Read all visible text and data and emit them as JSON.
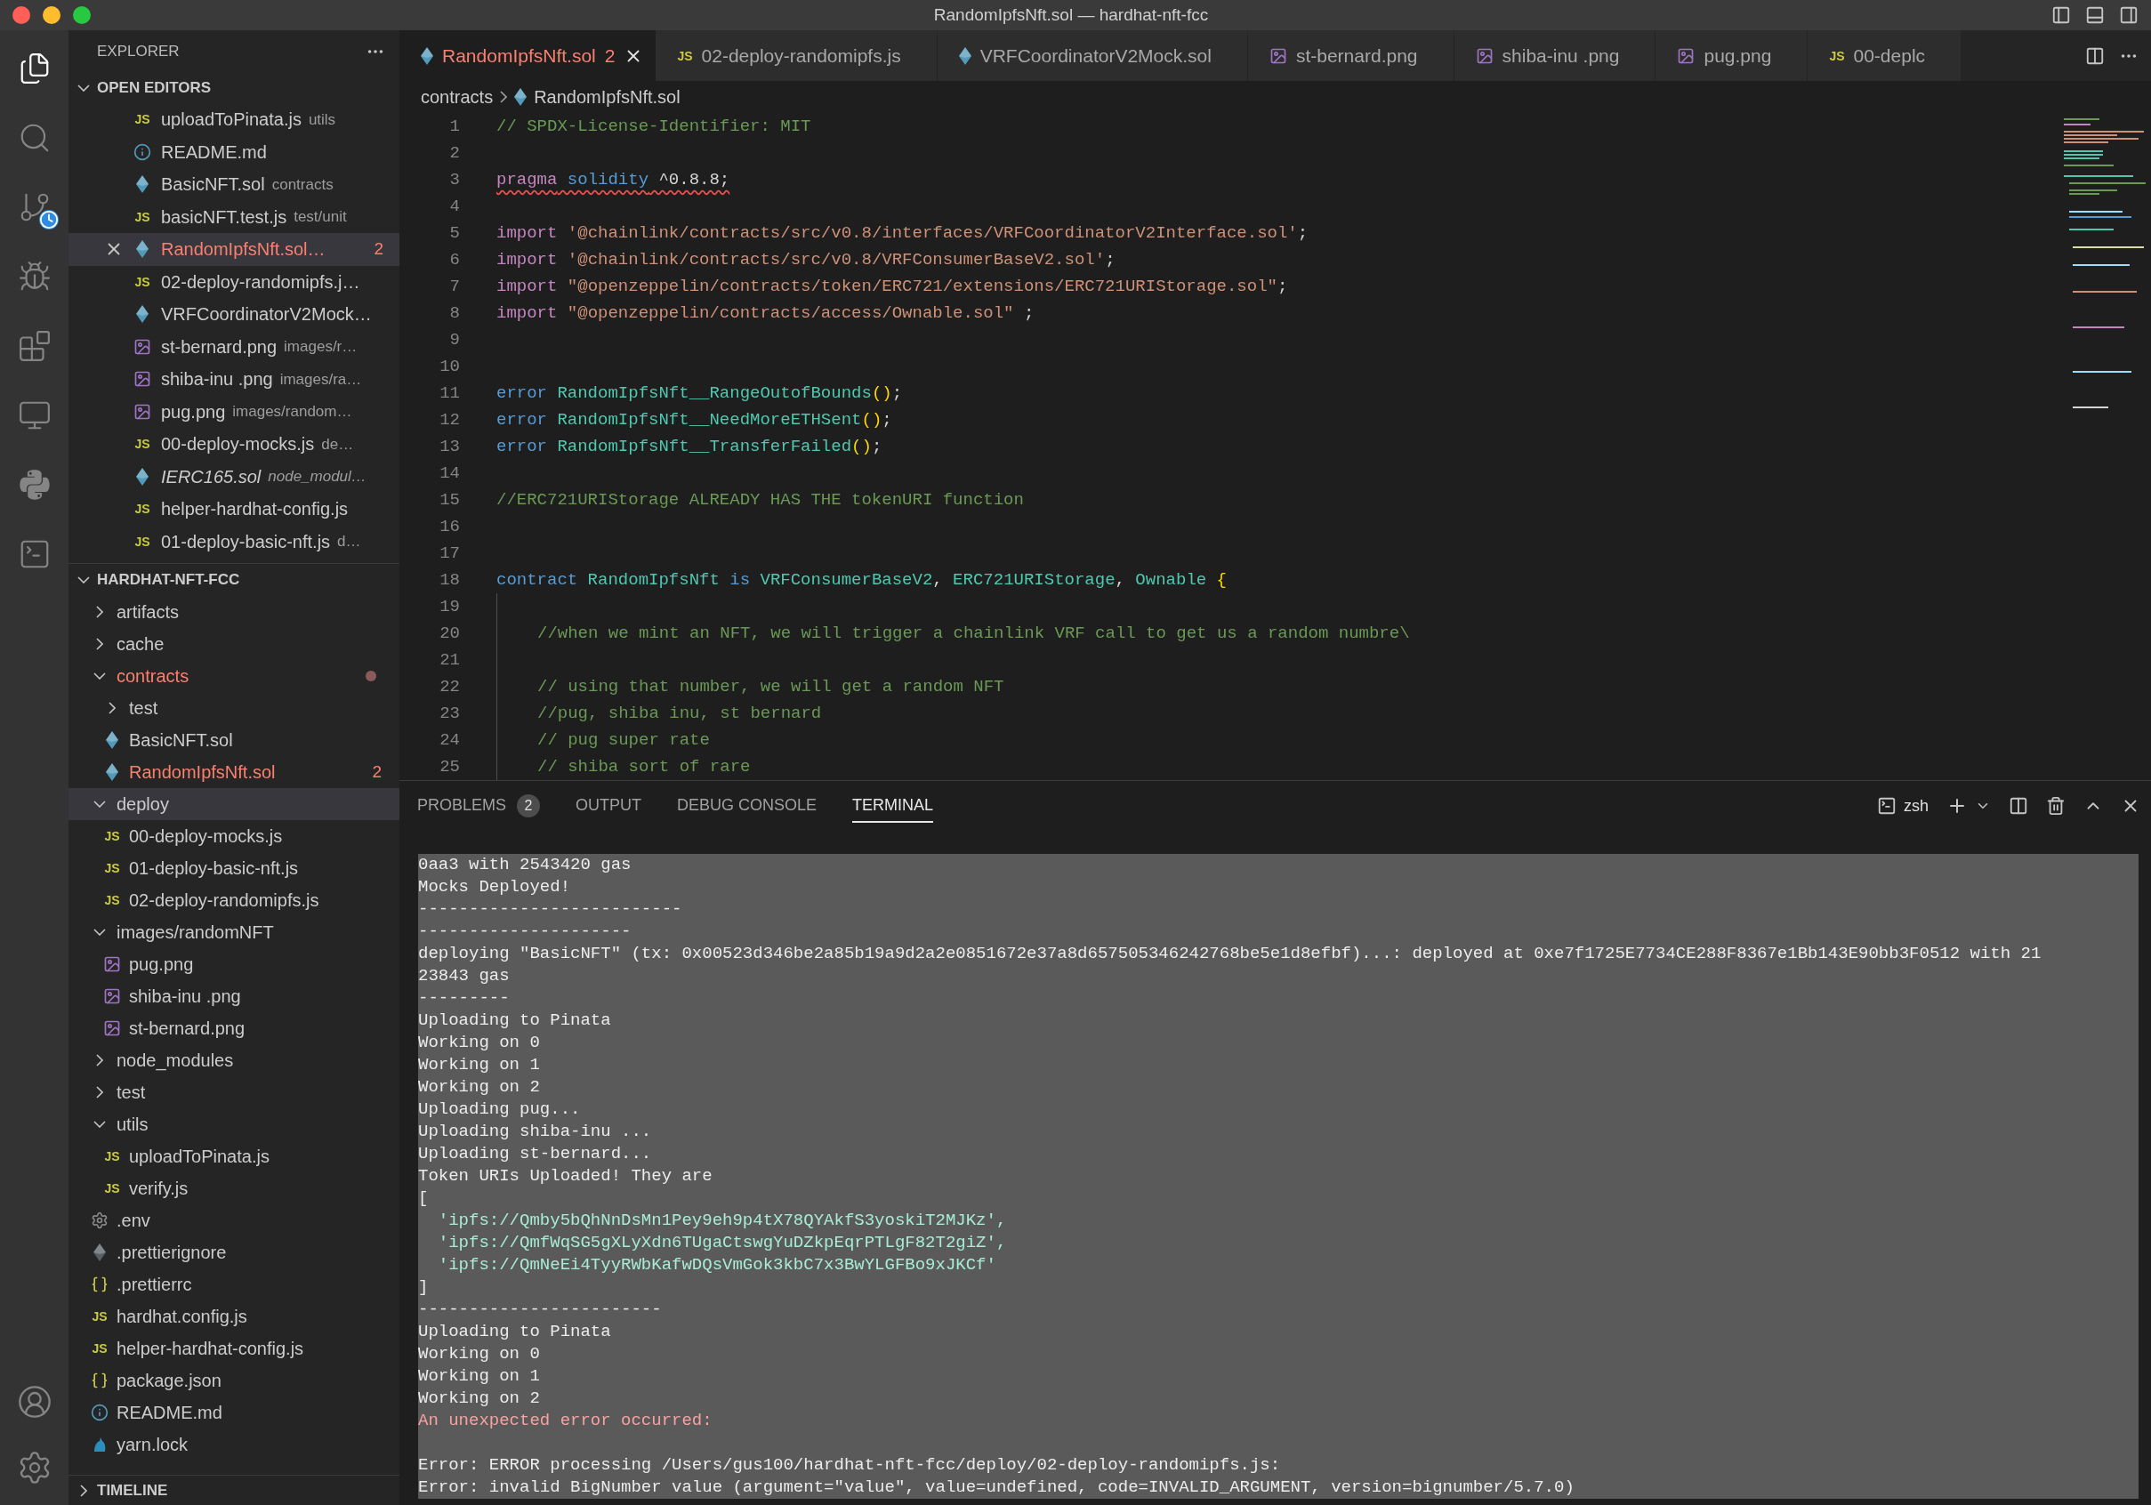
{
  "window": {
    "title": "RandomIpfsNft.sol — hardhat-nft-fcc"
  },
  "activity_bar": [
    {
      "selected": true
    },
    {
      "selected": false
    },
    {
      "selected": false
    },
    {
      "selected": false
    },
    {
      "selected": false
    },
    {
      "selected": false
    },
    {
      "selected": false
    },
    {
      "selected": false
    }
  ],
  "sidebar": {
    "title": "EXPLORER",
    "open_editors": {
      "title": "OPEN EDITORS",
      "expanded": true,
      "items": [
        {
          "name": "uploadToPinata.js",
          "detail": "utils",
          "kind": "js",
          "icon_label": "JS",
          "selected": false,
          "error": false,
          "preview": false
        },
        {
          "name": "README.md",
          "kind": "info",
          "selected": false,
          "error": false,
          "preview": false
        },
        {
          "name": "BasicNFT.sol",
          "detail": "contracts",
          "kind": "sol",
          "selected": false,
          "error": false,
          "preview": false
        },
        {
          "name": "basicNFT.test.js",
          "detail": "test/unit",
          "kind": "js",
          "icon_label": "JS",
          "selected": false,
          "error": false,
          "preview": false
        },
        {
          "name": "RandomIpfsNft.sol…",
          "kind": "sol",
          "problems": "2",
          "selected": true,
          "error": true,
          "preview": false
        },
        {
          "name": "02-deploy-randomipfs.j…",
          "kind": "js",
          "icon_label": "JS",
          "selected": false,
          "error": false,
          "preview": false
        },
        {
          "name": "VRFCoordinatorV2Mock…",
          "kind": "sol",
          "selected": false,
          "error": false,
          "preview": false
        },
        {
          "name": "st-bernard.png",
          "detail": "images/r…",
          "kind": "image",
          "selected": false,
          "error": false,
          "preview": false
        },
        {
          "name": "shiba-inu .png",
          "detail": "images/ra…",
          "kind": "image",
          "selected": false,
          "error": false,
          "preview": false
        },
        {
          "name": "pug.png",
          "detail": "images/random…",
          "kind": "image",
          "selected": false,
          "error": false,
          "preview": false
        },
        {
          "name": "00-deploy-mocks.js",
          "detail": "de…",
          "kind": "js",
          "icon_label": "JS",
          "selected": false,
          "error": false,
          "preview": false
        },
        {
          "name": "IERC165.sol",
          "detail": "node_modul…",
          "kind": "sol",
          "selected": false,
          "error": false,
          "preview": true
        },
        {
          "name": "helper-hardhat-config.js",
          "kind": "js",
          "icon_label": "JS",
          "selected": false,
          "error": false,
          "preview": false
        },
        {
          "name": "01-deploy-basic-nft.js",
          "detail": "d…",
          "kind": "js",
          "icon_label": "JS",
          "selected": false,
          "error": false,
          "preview": false
        }
      ]
    },
    "project": {
      "title": "HARDHAT-NFT-FCC",
      "expanded": true,
      "children": [
        {
          "name": "artifacts",
          "kind": "folder",
          "expanded": false,
          "selected": false,
          "error": false
        },
        {
          "name": "cache",
          "kind": "folder",
          "expanded": false,
          "selected": false,
          "error": false
        },
        {
          "name": "contracts",
          "kind": "folder",
          "expanded": true,
          "selected": false,
          "error": true,
          "children": [
            {
              "name": "test",
              "kind": "folder",
              "expanded": false,
              "selected": false,
              "error": false
            },
            {
              "name": "BasicNFT.sol",
              "kind": "sol",
              "selected": false,
              "error": false
            },
            {
              "name": "RandomIpfsNft.sol",
              "kind": "sol",
              "problems": "2",
              "selected": false,
              "error": true
            }
          ]
        },
        {
          "name": "deploy",
          "kind": "folder",
          "expanded": true,
          "selected": true,
          "error": false,
          "children": [
            {
              "name": "00-deploy-mocks.js",
              "kind": "js",
              "icon_label": "JS",
              "selected": false,
              "error": false
            },
            {
              "name": "01-deploy-basic-nft.js",
              "kind": "js",
              "icon_label": "JS",
              "selected": false,
              "error": false
            },
            {
              "name": "02-deploy-randomipfs.js",
              "kind": "js",
              "icon_label": "JS",
              "selected": false,
              "error": false
            }
          ]
        },
        {
          "name": "images/randomNFT",
          "kind": "folder",
          "expanded": true,
          "selected": false,
          "error": false,
          "children": [
            {
              "name": "pug.png",
              "kind": "image",
              "selected": false,
              "error": false
            },
            {
              "name": "shiba-inu .png",
              "kind": "image",
              "selected": false,
              "error": false
            },
            {
              "name": "st-bernard.png",
              "kind": "image",
              "selected": false,
              "error": false
            }
          ]
        },
        {
          "name": "node_modules",
          "kind": "folder",
          "expanded": false,
          "selected": false,
          "error": false
        },
        {
          "name": "test",
          "kind": "folder",
          "expanded": false,
          "selected": false,
          "error": false
        },
        {
          "name": "utils",
          "kind": "folder",
          "expanded": true,
          "selected": false,
          "error": false,
          "children": [
            {
              "name": "uploadToPinata.js",
              "kind": "js",
              "icon_label": "JS",
              "selected": false,
              "error": false
            },
            {
              "name": "verify.js",
              "kind": "js",
              "icon_label": "JS",
              "selected": false,
              "error": false
            }
          ]
        },
        {
          "name": ".env",
          "kind": "gear",
          "selected": false,
          "error": false
        },
        {
          "name": ".prettierignore",
          "kind": "ignore",
          "selected": false,
          "error": false
        },
        {
          "name": ".prettierrc",
          "kind": "braces",
          "selected": false,
          "error": false
        },
        {
          "name": "hardhat.config.js",
          "kind": "js",
          "icon_label": "JS",
          "selected": false,
          "error": false
        },
        {
          "name": "helper-hardhat-config.js",
          "kind": "js",
          "icon_label": "JS",
          "selected": false,
          "error": false
        },
        {
          "name": "package.json",
          "kind": "braces",
          "selected": false,
          "error": false
        },
        {
          "name": "README.md",
          "kind": "info",
          "selected": false,
          "error": false
        },
        {
          "name": "yarn.lock",
          "kind": "yarn",
          "selected": false,
          "error": false
        }
      ]
    },
    "timeline": {
      "title": "TIMELINE",
      "expanded": false
    }
  },
  "tabs": [
    {
      "label": "RandomIpfsNft.sol",
      "kind": "sol",
      "problems": "2",
      "selected": true,
      "error": true
    },
    {
      "label": "02-deploy-randomipfs.js",
      "kind": "js",
      "icon_label": "JS",
      "selected": false,
      "error": false
    },
    {
      "label": "VRFCoordinatorV2Mock.sol",
      "kind": "sol",
      "selected": false,
      "error": false
    },
    {
      "label": "st-bernard.png",
      "kind": "image",
      "selected": false,
      "error": false
    },
    {
      "label": "shiba-inu .png",
      "kind": "image",
      "selected": false,
      "error": false
    },
    {
      "label": "pug.png",
      "kind": "image",
      "selected": false,
      "error": false
    },
    {
      "label": "00-deplc",
      "kind": "js",
      "icon_label": "JS",
      "selected": false,
      "error": false
    }
  ],
  "breadcrumbs": [
    {
      "label": "contracts",
      "kind": "folder"
    },
    {
      "label": "RandomIpfsNft.sol",
      "kind": "sol"
    }
  ],
  "editor": {
    "lines": [
      {
        "n": "1",
        "tokens": [
          {
            "kind": "comment",
            "text": "// SPDX-License-Identifier: MIT"
          }
        ]
      },
      {
        "n": "2"
      },
      {
        "n": "3",
        "error": true,
        "tokens": [
          {
            "kind": "keyword",
            "text": "pragma"
          },
          {
            "kind": "builtin",
            "text": " solidity"
          },
          {
            "kind": "plain",
            "text": " ^0.8.8;"
          }
        ]
      },
      {
        "n": "4"
      },
      {
        "n": "5",
        "tokens": [
          {
            "kind": "keyword",
            "text": "import"
          },
          {
            "kind": "string",
            "text": " '@chainlink/contracts/src/v0.8/interfaces/VRFCoordinatorV2Interface.sol'"
          },
          {
            "kind": "plain",
            "text": ";"
          }
        ]
      },
      {
        "n": "6",
        "tokens": [
          {
            "kind": "keyword",
            "text": "import"
          },
          {
            "kind": "string",
            "text": " '@chainlink/contracts/src/v0.8/VRFConsumerBaseV2.sol'"
          },
          {
            "kind": "plain",
            "text": ";"
          }
        ]
      },
      {
        "n": "7",
        "tokens": [
          {
            "kind": "keyword",
            "text": "import"
          },
          {
            "kind": "string",
            "text": " \"@openzeppelin/contracts/token/ERC721/extensions/ERC721URIStorage.sol\""
          },
          {
            "kind": "plain",
            "text": ";"
          }
        ]
      },
      {
        "n": "8",
        "tokens": [
          {
            "kind": "keyword",
            "text": "import"
          },
          {
            "kind": "string",
            "text": " \"@openzeppelin/contracts/access/Ownable.sol\""
          },
          {
            "kind": "plain",
            "text": " ;"
          }
        ]
      },
      {
        "n": "9"
      },
      {
        "n": "10"
      },
      {
        "n": "11",
        "tokens": [
          {
            "kind": "builtin",
            "text": "error"
          },
          {
            "kind": "type",
            "text": " RandomIpfsNft__RangeOutofBounds"
          },
          {
            "kind": "bracket",
            "text": "()"
          },
          {
            "kind": "plain",
            "text": ";"
          }
        ]
      },
      {
        "n": "12",
        "tokens": [
          {
            "kind": "builtin",
            "text": "error"
          },
          {
            "kind": "type",
            "text": " RandomIpfsNft__NeedMoreETHSent"
          },
          {
            "kind": "bracket",
            "text": "()"
          },
          {
            "kind": "plain",
            "text": ";"
          }
        ]
      },
      {
        "n": "13",
        "tokens": [
          {
            "kind": "builtin",
            "text": "error"
          },
          {
            "kind": "type",
            "text": " RandomIpfsNft__TransferFailed"
          },
          {
            "kind": "bracket",
            "text": "()"
          },
          {
            "kind": "plain",
            "text": ";"
          }
        ]
      },
      {
        "n": "14"
      },
      {
        "n": "15",
        "tokens": [
          {
            "kind": "comment",
            "text": "//ERC721URIStorage ALREADY HAS THE tokenURI function"
          }
        ]
      },
      {
        "n": "16"
      },
      {
        "n": "17"
      },
      {
        "n": "18",
        "tokens": [
          {
            "kind": "builtin",
            "text": "contract"
          },
          {
            "kind": "type",
            "text": " RandomIpfsNft"
          },
          {
            "kind": "builtin",
            "text": " is"
          },
          {
            "kind": "type",
            "text": " VRFConsumerBaseV2"
          },
          {
            "kind": "plain",
            "text": ","
          },
          {
            "kind": "type",
            "text": " ERC721URIStorage"
          },
          {
            "kind": "plain",
            "text": ","
          },
          {
            "kind": "type",
            "text": " Ownable"
          },
          {
            "kind": "bracket",
            "text": " {"
          }
        ]
      },
      {
        "n": "19",
        "indented": true
      },
      {
        "n": "20",
        "indented": true,
        "tokens": [
          {
            "kind": "comment",
            "text": "//when we mint an NFT, we will trigger a chainlink VRF call to get us a random numbre\\"
          }
        ]
      },
      {
        "n": "21",
        "indented": true
      },
      {
        "n": "22",
        "indented": true,
        "tokens": [
          {
            "kind": "comment",
            "text": "// using that number, we will get a random NFT"
          }
        ]
      },
      {
        "n": "23",
        "indented": true,
        "tokens": [
          {
            "kind": "comment",
            "text": "//pug, shiba inu, st bernard"
          }
        ]
      },
      {
        "n": "24",
        "indented": true,
        "tokens": [
          {
            "kind": "comment",
            "text": "// pug super rate"
          }
        ]
      },
      {
        "n": "25",
        "indented": true,
        "tokens": [
          {
            "kind": "comment",
            "text": "// shiba sort of rare"
          }
        ]
      }
    ]
  },
  "panel": {
    "tabs": [
      {
        "label": "PROBLEMS",
        "badge": "2",
        "selected": false
      },
      {
        "label": "OUTPUT",
        "selected": false
      },
      {
        "label": "DEBUG CONSOLE",
        "selected": false
      },
      {
        "label": "TERMINAL",
        "selected": true
      }
    ],
    "shell": "zsh",
    "terminal": [
      {
        "kind": "out",
        "text": "0aa3 with 2543420 gas"
      },
      {
        "kind": "out",
        "text": "Mocks Deployed!"
      },
      {
        "kind": "out",
        "text": "--------------------------"
      },
      {
        "kind": "out",
        "text": "---------------------"
      },
      {
        "kind": "out",
        "text": "deploying \"BasicNFT\" (tx: 0x00523d346be2a85b19a9d2a2e0851672e37a8d657505346242768be5e1d8efbf)...: deployed at 0xe7f1725E7734CE288F8367e1Bb143E90bb3F0512 with 21"
      },
      {
        "kind": "out",
        "text": "23843 gas"
      },
      {
        "kind": "out",
        "text": "---------"
      },
      {
        "kind": "out",
        "text": "Uploading to Pinata"
      },
      {
        "kind": "out",
        "text": "Working on 0"
      },
      {
        "kind": "out",
        "text": "Working on 1"
      },
      {
        "kind": "out",
        "text": "Working on 2"
      },
      {
        "kind": "out",
        "text": "Uploading pug..."
      },
      {
        "kind": "out",
        "text": "Uploading shiba-inu ..."
      },
      {
        "kind": "out",
        "text": "Uploading st-bernard..."
      },
      {
        "kind": "out",
        "text": "Token URIs Uploaded! They are"
      },
      {
        "kind": "out",
        "text": "["
      },
      {
        "kind": "string",
        "text": "  'ipfs://Qmby5bQhNnDsMn1Pey9eh9p4tX78QYAkfS3yoskiT2MJKz',"
      },
      {
        "kind": "string",
        "text": "  'ipfs://QmfWqSG5gXLyXdn6TUgaCtswgYuDZkpEqrPTLgF82T2giZ',"
      },
      {
        "kind": "string",
        "text": "  'ipfs://QmNeEi4TyyRWbKafwDQsVmGok3kbC7x3BwYLGFBo9xJKCf'"
      },
      {
        "kind": "out",
        "text": "]"
      },
      {
        "kind": "out",
        "text": "------------------------"
      },
      {
        "kind": "out",
        "text": "Uploading to Pinata"
      },
      {
        "kind": "out",
        "text": "Working on 0"
      },
      {
        "kind": "out",
        "text": "Working on 1"
      },
      {
        "kind": "out",
        "text": "Working on 2"
      },
      {
        "kind": "error",
        "text": "An unexpected error occurred:"
      },
      {
        "kind": "blank"
      },
      {
        "kind": "out",
        "text": "Error: ERROR processing /Users/gus100/hardhat-nft-fcc/deploy/02-deploy-randomipfs.js:"
      },
      {
        "kind": "out",
        "text": "Error: invalid BigNumber value (argument=\"value\", value=undefined, code=INVALID_ARGUMENT, version=bignumber/5.7.0)"
      }
    ]
  }
}
